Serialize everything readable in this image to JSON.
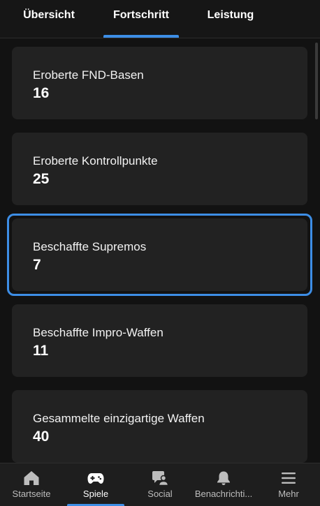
{
  "tabs": [
    {
      "label": "Übersicht",
      "active": false
    },
    {
      "label": "Fortschritt",
      "active": true
    },
    {
      "label": "Leistung",
      "active": false
    }
  ],
  "stats": [
    {
      "label": "Eroberte FND-Basen",
      "value": "16"
    },
    {
      "label": "Eroberte Kontrollpunkte",
      "value": "25"
    },
    {
      "label": "Beschaffte Supremos",
      "value": "7"
    },
    {
      "label": "Beschaffte Impro-Waffen",
      "value": "11"
    },
    {
      "label": "Gesammelte einzigartige Waffen",
      "value": "40"
    }
  ],
  "focused_stat_index": 2,
  "bottom_nav": [
    {
      "label": "Startseite",
      "icon": "home-icon",
      "active": false
    },
    {
      "label": "Spiele",
      "icon": "gamepad-icon",
      "active": true
    },
    {
      "label": "Social",
      "icon": "social-icon",
      "active": false
    },
    {
      "label": "Benachrichti...",
      "icon": "bell-icon",
      "active": false
    },
    {
      "label": "Mehr",
      "icon": "menu-icon",
      "active": false
    }
  ],
  "colors": {
    "accent": "#3d8ee6",
    "background": "#121212",
    "card": "#222222",
    "nav_background": "#1e1e1e"
  }
}
